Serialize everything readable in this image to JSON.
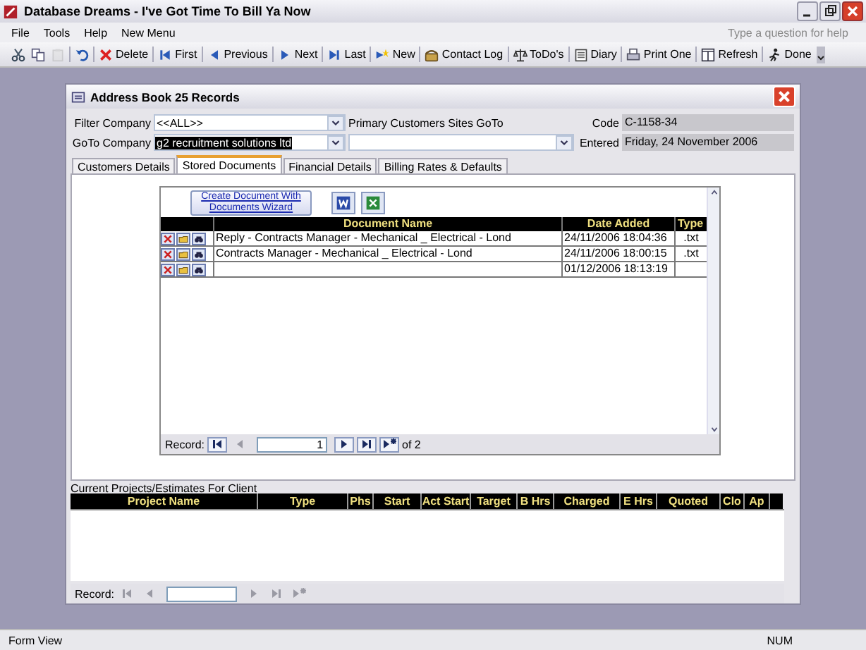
{
  "window": {
    "title": "Database Dreams - I've Got Time To Bill Ya Now"
  },
  "menu": [
    "File",
    "Tools",
    "Help",
    "New Menu"
  ],
  "help_search": {
    "placeholder": "Type a question for help"
  },
  "toolbar": [
    {
      "kind": "cut",
      "disabled": false
    },
    {
      "kind": "copy",
      "disabled": false
    },
    {
      "kind": "paste",
      "disabled": true
    },
    {
      "kind": "undo",
      "disabled": false
    },
    {
      "kind": "delete",
      "label": "Delete",
      "disabled": false
    },
    {
      "kind": "first",
      "label": "First",
      "disabled": false
    },
    {
      "kind": "previous",
      "label": "Previous",
      "disabled": false
    },
    {
      "kind": "next",
      "label": "Next",
      "disabled": false
    },
    {
      "kind": "last",
      "label": "Last",
      "disabled": false
    },
    {
      "kind": "new",
      "label": "New",
      "disabled": false
    },
    {
      "kind": "contact-log",
      "label": "Contact Log",
      "disabled": false
    },
    {
      "kind": "todo",
      "label": "ToDo's",
      "disabled": false
    },
    {
      "kind": "diary",
      "label": "Diary",
      "disabled": false
    },
    {
      "kind": "print",
      "label": "Print One",
      "disabled": false
    },
    {
      "kind": "refresh",
      "label": "Refresh",
      "disabled": false
    },
    {
      "kind": "done",
      "label": "Done",
      "disabled": false
    }
  ],
  "form": {
    "title": "Address Book 25 Records",
    "filter_company": {
      "label": "Filter Company",
      "value": "<<ALL>>"
    },
    "goto_company": {
      "label": "GoTo Company",
      "value": "g2 recruitment solutions ltd",
      "value_selected": true
    },
    "primary_sites": {
      "label": "Primary Customers Sites GoTo"
    },
    "code": {
      "label": "Code",
      "value": "C-1158-34"
    },
    "entered": {
      "label": "Entered",
      "value": "Friday, 24 November 2006"
    },
    "tabs": [
      {
        "label": "Customers Details",
        "selected": false
      },
      {
        "label": "Stored Documents",
        "selected": true
      },
      {
        "label": "Financial Details",
        "selected": false
      },
      {
        "label": "Billing Rates & Defaults",
        "selected": false
      }
    ],
    "documents": {
      "wizard_button": "Create Document With Documents Wizard",
      "columns": [
        "Document Name",
        "Date Added",
        "Type"
      ],
      "rows": [
        {
          "name": "Reply - Contracts Manager - Mechanical _ Electrical - Lond",
          "date": "24/11/2006 18:04:36",
          "type": ".txt"
        },
        {
          "name": "Contracts Manager - Mechanical _ Electrical - Lond",
          "date": "24/11/2006 18:00:15",
          "type": ".txt"
        },
        {
          "date": "01/12/2006 18:13:19"
        }
      ],
      "record_nav": {
        "label": "Record:",
        "value": "1",
        "total": "of 2",
        "buttons": [
          {
            "kind": "first",
            "disabled": false
          },
          {
            "kind": "previous",
            "disabled": true
          },
          {
            "kind": "next",
            "disabled": false
          },
          {
            "kind": "last",
            "disabled": false
          },
          {
            "kind": "new",
            "disabled": false
          }
        ]
      }
    },
    "projects": {
      "title": "Current Projects/Estimates For Client",
      "columns": [
        "Project Name",
        "Type",
        "Phs",
        "Start",
        "Act Start",
        "Target",
        "B Hrs",
        "Charged",
        "E Hrs",
        "Quoted",
        "Clo",
        "Ap"
      ],
      "record_nav": {
        "label": "Record:",
        "buttons": [
          {
            "kind": "first",
            "disabled": true
          },
          {
            "kind": "previous",
            "disabled": true
          },
          {
            "kind": "next",
            "disabled": true
          },
          {
            "kind": "last",
            "disabled": true
          },
          {
            "kind": "new",
            "disabled": true
          }
        ]
      }
    }
  },
  "status_bar": [
    "Form View",
    "NUM"
  ]
}
